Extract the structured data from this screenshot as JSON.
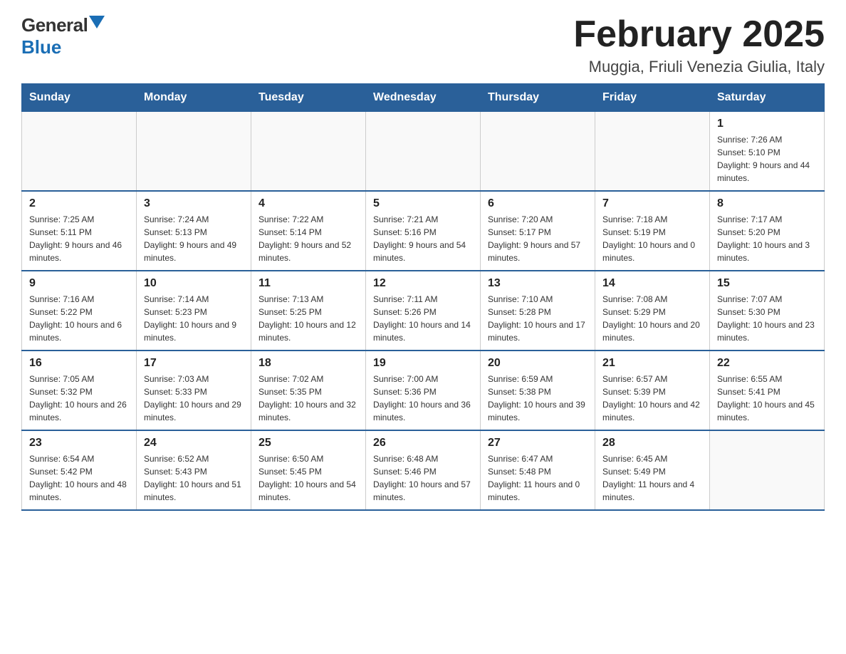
{
  "header": {
    "logo_general": "General",
    "logo_blue": "Blue",
    "title": "February 2025",
    "subtitle": "Muggia, Friuli Venezia Giulia, Italy"
  },
  "days_of_week": [
    "Sunday",
    "Monday",
    "Tuesday",
    "Wednesday",
    "Thursday",
    "Friday",
    "Saturday"
  ],
  "weeks": [
    [
      {
        "day": "",
        "info": ""
      },
      {
        "day": "",
        "info": ""
      },
      {
        "day": "",
        "info": ""
      },
      {
        "day": "",
        "info": ""
      },
      {
        "day": "",
        "info": ""
      },
      {
        "day": "",
        "info": ""
      },
      {
        "day": "1",
        "info": "Sunrise: 7:26 AM\nSunset: 5:10 PM\nDaylight: 9 hours and 44 minutes."
      }
    ],
    [
      {
        "day": "2",
        "info": "Sunrise: 7:25 AM\nSunset: 5:11 PM\nDaylight: 9 hours and 46 minutes."
      },
      {
        "day": "3",
        "info": "Sunrise: 7:24 AM\nSunset: 5:13 PM\nDaylight: 9 hours and 49 minutes."
      },
      {
        "day": "4",
        "info": "Sunrise: 7:22 AM\nSunset: 5:14 PM\nDaylight: 9 hours and 52 minutes."
      },
      {
        "day": "5",
        "info": "Sunrise: 7:21 AM\nSunset: 5:16 PM\nDaylight: 9 hours and 54 minutes."
      },
      {
        "day": "6",
        "info": "Sunrise: 7:20 AM\nSunset: 5:17 PM\nDaylight: 9 hours and 57 minutes."
      },
      {
        "day": "7",
        "info": "Sunrise: 7:18 AM\nSunset: 5:19 PM\nDaylight: 10 hours and 0 minutes."
      },
      {
        "day": "8",
        "info": "Sunrise: 7:17 AM\nSunset: 5:20 PM\nDaylight: 10 hours and 3 minutes."
      }
    ],
    [
      {
        "day": "9",
        "info": "Sunrise: 7:16 AM\nSunset: 5:22 PM\nDaylight: 10 hours and 6 minutes."
      },
      {
        "day": "10",
        "info": "Sunrise: 7:14 AM\nSunset: 5:23 PM\nDaylight: 10 hours and 9 minutes."
      },
      {
        "day": "11",
        "info": "Sunrise: 7:13 AM\nSunset: 5:25 PM\nDaylight: 10 hours and 12 minutes."
      },
      {
        "day": "12",
        "info": "Sunrise: 7:11 AM\nSunset: 5:26 PM\nDaylight: 10 hours and 14 minutes."
      },
      {
        "day": "13",
        "info": "Sunrise: 7:10 AM\nSunset: 5:28 PM\nDaylight: 10 hours and 17 minutes."
      },
      {
        "day": "14",
        "info": "Sunrise: 7:08 AM\nSunset: 5:29 PM\nDaylight: 10 hours and 20 minutes."
      },
      {
        "day": "15",
        "info": "Sunrise: 7:07 AM\nSunset: 5:30 PM\nDaylight: 10 hours and 23 minutes."
      }
    ],
    [
      {
        "day": "16",
        "info": "Sunrise: 7:05 AM\nSunset: 5:32 PM\nDaylight: 10 hours and 26 minutes."
      },
      {
        "day": "17",
        "info": "Sunrise: 7:03 AM\nSunset: 5:33 PM\nDaylight: 10 hours and 29 minutes."
      },
      {
        "day": "18",
        "info": "Sunrise: 7:02 AM\nSunset: 5:35 PM\nDaylight: 10 hours and 32 minutes."
      },
      {
        "day": "19",
        "info": "Sunrise: 7:00 AM\nSunset: 5:36 PM\nDaylight: 10 hours and 36 minutes."
      },
      {
        "day": "20",
        "info": "Sunrise: 6:59 AM\nSunset: 5:38 PM\nDaylight: 10 hours and 39 minutes."
      },
      {
        "day": "21",
        "info": "Sunrise: 6:57 AM\nSunset: 5:39 PM\nDaylight: 10 hours and 42 minutes."
      },
      {
        "day": "22",
        "info": "Sunrise: 6:55 AM\nSunset: 5:41 PM\nDaylight: 10 hours and 45 minutes."
      }
    ],
    [
      {
        "day": "23",
        "info": "Sunrise: 6:54 AM\nSunset: 5:42 PM\nDaylight: 10 hours and 48 minutes."
      },
      {
        "day": "24",
        "info": "Sunrise: 6:52 AM\nSunset: 5:43 PM\nDaylight: 10 hours and 51 minutes."
      },
      {
        "day": "25",
        "info": "Sunrise: 6:50 AM\nSunset: 5:45 PM\nDaylight: 10 hours and 54 minutes."
      },
      {
        "day": "26",
        "info": "Sunrise: 6:48 AM\nSunset: 5:46 PM\nDaylight: 10 hours and 57 minutes."
      },
      {
        "day": "27",
        "info": "Sunrise: 6:47 AM\nSunset: 5:48 PM\nDaylight: 11 hours and 0 minutes."
      },
      {
        "day": "28",
        "info": "Sunrise: 6:45 AM\nSunset: 5:49 PM\nDaylight: 11 hours and 4 minutes."
      },
      {
        "day": "",
        "info": ""
      }
    ]
  ]
}
